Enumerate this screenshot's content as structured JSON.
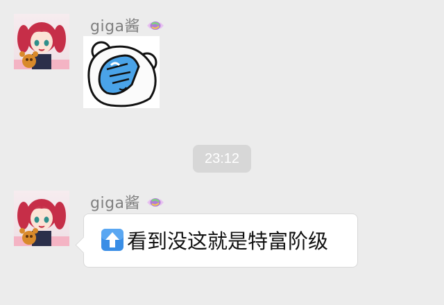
{
  "messages": [
    {
      "sender": "giga酱",
      "avatar_icon": "anime-girl-avatar",
      "badge_icon": "candy-icon",
      "content_type": "sticker",
      "sticker_icon": "bear-facepalm-sticker"
    },
    {
      "sender": "giga酱",
      "avatar_icon": "anime-girl-avatar",
      "badge_icon": "candy-icon",
      "content_type": "text",
      "emoji_icon": "up-arrow-emoji",
      "text": "看到没这就是特富阶级"
    }
  ],
  "timestamp": "23:12",
  "colors": {
    "background": "#ececec",
    "bubble": "#ffffff",
    "timestamp_bg": "#d7d7d7",
    "sender_text": "#7f7f7f",
    "emoji_blue": "#3a8ee6"
  }
}
